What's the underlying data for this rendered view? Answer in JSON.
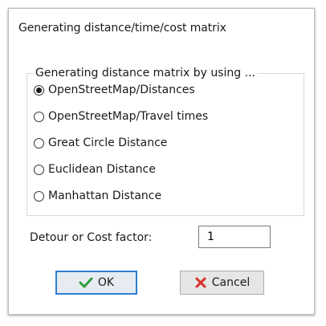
{
  "dialog": {
    "title": "Generating distance/time/cost matrix"
  },
  "method_group": {
    "label": "Generating distance matrix by using ...",
    "options": [
      {
        "label": "OpenStreetMap/Distances",
        "selected": true
      },
      {
        "label": "OpenStreetMap/Travel times",
        "selected": false
      },
      {
        "label": "Great Circle Distance",
        "selected": false
      },
      {
        "label": "Euclidean Distance",
        "selected": false
      },
      {
        "label": "Manhattan Distance",
        "selected": false
      }
    ]
  },
  "factor": {
    "label": "Detour or Cost factor:",
    "value": "1"
  },
  "buttons": {
    "ok_label": "OK",
    "ok_icon": "check-icon",
    "cancel_label": "Cancel",
    "cancel_icon": "cross-icon"
  },
  "colors": {
    "ok_icon": "#2e9e3a",
    "cancel_icon": "#d9312b",
    "default_button_border": "#2f7fd2"
  }
}
